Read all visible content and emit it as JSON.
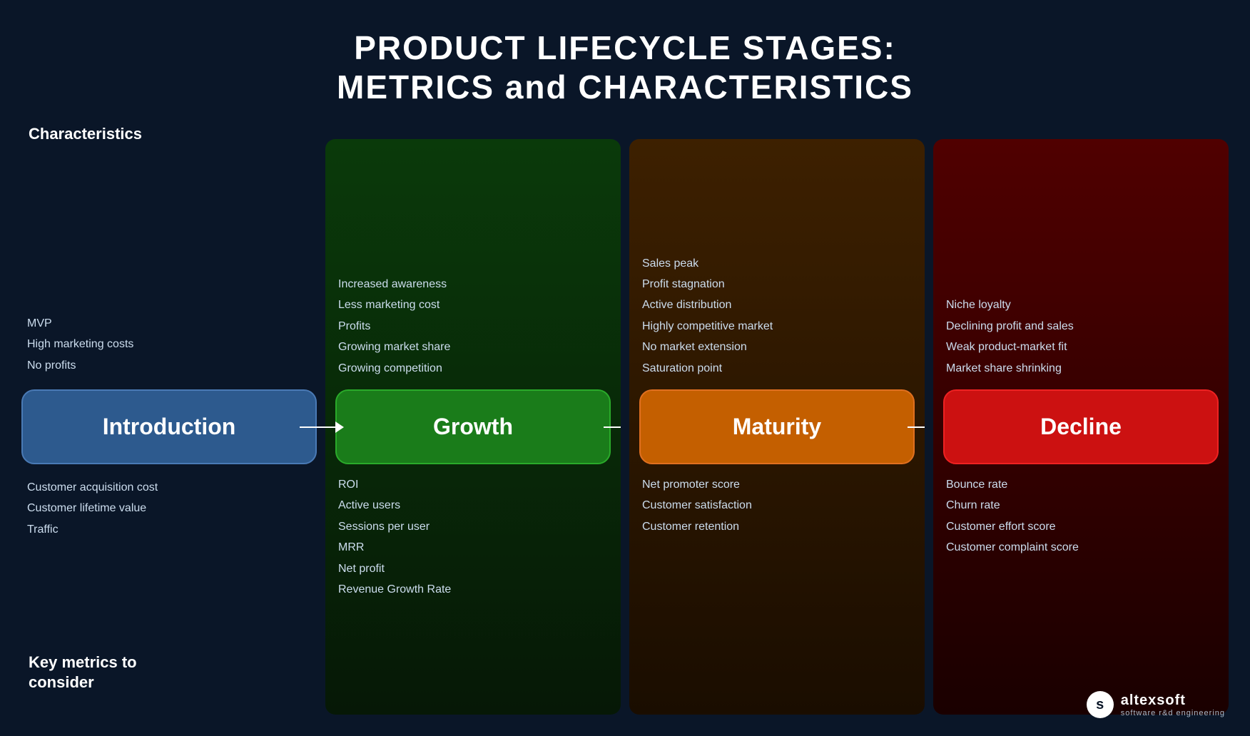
{
  "title": {
    "line1": "PRODUCT LIFECYCLE STAGES:",
    "line2": "METRICS and CHARACTERISTICS"
  },
  "labels": {
    "characteristics": "Characteristics",
    "key_metrics": "Key metrics to\nconsider"
  },
  "stages": [
    {
      "id": "introduction",
      "label": "Introduction",
      "color_class": "stage-introduction",
      "characteristics": [
        "MVP",
        "High marketing costs",
        "No profits"
      ],
      "metrics": [
        "Customer acquisition cost",
        "Customer lifetime value",
        "Traffic"
      ]
    },
    {
      "id": "growth",
      "label": "Growth",
      "color_class": "stage-growth",
      "char_class": "growth-char",
      "met_class": "growth-met",
      "bg_color": "#0a2a0a",
      "characteristics": [
        "Increased awareness",
        "Less marketing cost",
        "Profits",
        "Growing market share",
        "Growing competition"
      ],
      "metrics": [
        "ROI",
        "Active users",
        "Sessions per user",
        "MRR",
        "Net profit",
        "Revenue Growth Rate"
      ]
    },
    {
      "id": "maturity",
      "label": "Maturity",
      "color_class": "stage-maturity",
      "char_class": "maturity-char",
      "met_class": "maturity-met",
      "bg_color": "#2a1500",
      "characteristics": [
        "Sales peak",
        "Profit stagnation",
        "Active distribution",
        "Highly competitive market",
        "No market extension",
        "Saturation point"
      ],
      "metrics": [
        "Net promoter score",
        "Customer satisfaction",
        "Customer retention"
      ]
    },
    {
      "id": "decline",
      "label": "Decline",
      "color_class": "stage-decline",
      "char_class": "decline-char",
      "met_class": "decline-met",
      "bg_color": "#2a0000",
      "characteristics": [
        "Niche loyalty",
        "Declining profit and sales",
        "Weak product-market fit",
        "Market share shrinking"
      ],
      "metrics": [
        "Bounce rate",
        "Churn rate",
        "Customer effort score",
        "Customer complaint score"
      ]
    }
  ],
  "logo": {
    "icon": "s",
    "name": "altexsoft",
    "subtitle": "software r&d engineering"
  }
}
